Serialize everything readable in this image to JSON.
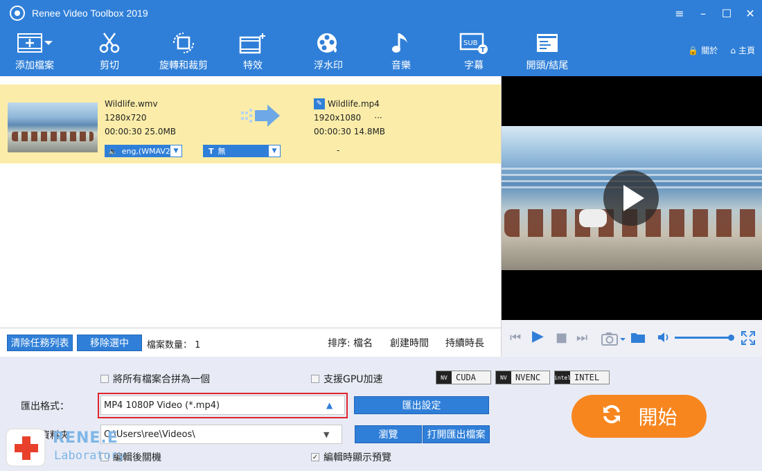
{
  "window": {
    "title": "Renee Video Toolbox 2019"
  },
  "toolbar": {
    "items": [
      {
        "label": "添加檔案",
        "icon": "add-file-icon"
      },
      {
        "label": "剪切",
        "icon": "scissors-icon"
      },
      {
        "label": "旋轉和裁剪",
        "icon": "rotate-crop-icon"
      },
      {
        "label": "特效",
        "icon": "effects-icon"
      },
      {
        "label": "浮水印",
        "icon": "watermark-icon"
      },
      {
        "label": "音樂",
        "icon": "music-icon"
      },
      {
        "label": "字幕",
        "icon": "subtitle-icon"
      },
      {
        "label": "開頭/結尾",
        "icon": "intro-outro-icon"
      }
    ],
    "about_label": "關於",
    "home_label": "主頁"
  },
  "task": {
    "source": {
      "name": "Wildlife.wmv",
      "resolution": "1280x720",
      "duration": "00:00:30",
      "size": "25.0MB"
    },
    "output": {
      "name": "Wildlife.mp4",
      "resolution": "1920x1080",
      "more": "···",
      "duration": "00:00:30",
      "size": "14.8MB"
    },
    "audio_track": "eng,(WMAV2",
    "subtitle": "無",
    "dash": "-"
  },
  "listbar": {
    "clear_label": "清除任務列表",
    "remove_label": "移除選中",
    "count_label": "檔案数量：",
    "count_value": "1",
    "sort_label": "排序:",
    "sort_name": "檔名",
    "sort_created": "創建時間",
    "sort_duration": "持續時長"
  },
  "bottom": {
    "merge_label": "將所有檔案合拼為一個",
    "gpu_label": "支援GPU加速",
    "badges": [
      "CUDA",
      "NVENC",
      "INTEL"
    ],
    "format_label": "匯出格式：",
    "format_value": "MP4 1080P Video (*.mp4)",
    "export_settings_label": "匯出設定",
    "folder_label": "資料夾",
    "folder_value": "C:\\Users\\ree\\Videos\\",
    "browse_label": "瀏覽",
    "open_folder_label": "打開匯出檔案",
    "shutdown_label": "編輯後關機",
    "preview_label": "編輯時顯示預覽",
    "preview_checked": true,
    "start_label": "開始"
  },
  "watermark": {
    "line1": "RENE.E",
    "line2": "Laboratory"
  },
  "colors": {
    "accent": "#2f7fd8",
    "start": "#f7861f",
    "highlight_row": "#fbeda9",
    "format_outline": "#e0242b"
  }
}
